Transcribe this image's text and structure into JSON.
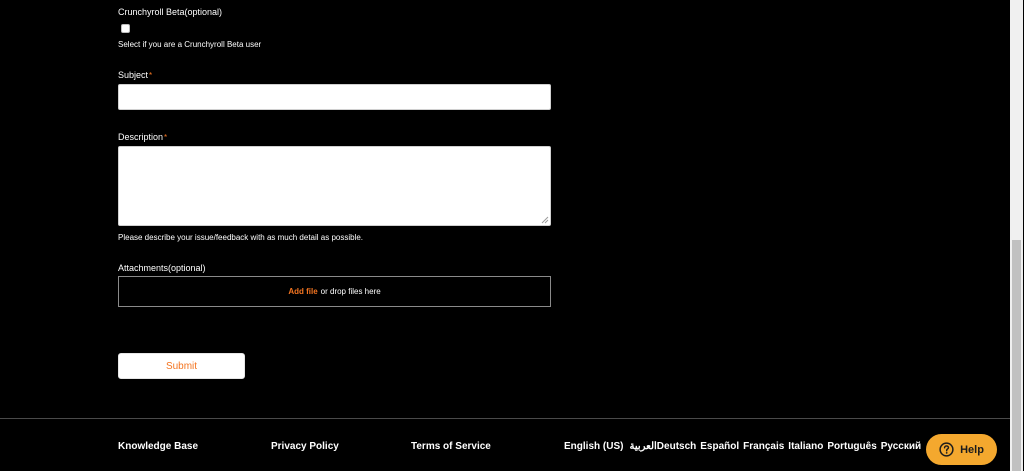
{
  "form": {
    "beta": {
      "label": "Crunchyroll Beta(optional)",
      "checked": false,
      "helper": "Select if you are a Crunchyroll Beta user"
    },
    "subject": {
      "label": "Subject",
      "required_mark": "*",
      "value": ""
    },
    "description": {
      "label": "Description",
      "required_mark": "*",
      "value": "",
      "helper": "Please describe your issue/feedback with as much detail as possible."
    },
    "attachments": {
      "label": "Attachments(optional)",
      "add_file": "Add file",
      "drop_text": "or drop files here"
    },
    "submit_label": "Submit"
  },
  "footer": {
    "links": [
      "Knowledge Base",
      "Privacy Policy",
      "Terms of Service"
    ],
    "languages": [
      "English (US)",
      "العربية",
      "Deutsch",
      "Español",
      "Français",
      "Italiano",
      "Português",
      "Русский"
    ]
  },
  "help_button": {
    "label": "Help",
    "icon": "question-circle-icon"
  },
  "colors": {
    "background": "#000000",
    "accent": "#f47521",
    "help_button": "#f4a82e"
  }
}
